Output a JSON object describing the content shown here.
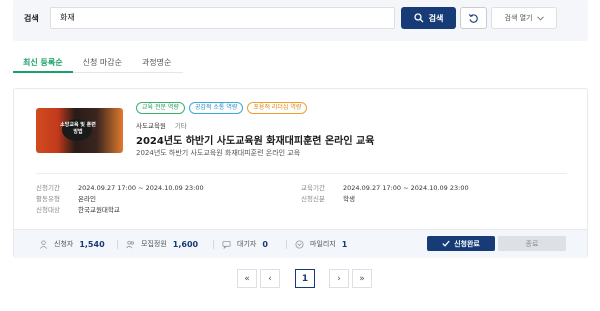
{
  "search": {
    "label": "검색",
    "value": "화재",
    "button_label": "검색",
    "open_label": "검색 열기"
  },
  "tabs": [
    {
      "label": "최신 등록순",
      "active": true
    },
    {
      "label": "신청 마감순",
      "active": false
    },
    {
      "label": "과정명순",
      "active": false
    }
  ],
  "course": {
    "thumbnail_text": "소방교육 및 훈련방법",
    "tags": [
      "교육 전문 역량",
      "공감적 소통 역량",
      "포용적 리더십 역량"
    ],
    "organization": "사도교육원",
    "category": "기타",
    "title": "2024년도 하반기 사도교육원 화재대피훈련 온라인 교육",
    "subtitle": "2024년도 하반기 사도교육원 화재대피훈련 온라인 교육",
    "info_left": [
      {
        "key": "신청기간",
        "value": "2024.09.27 17:00 ~ 2024.10.09 23:00"
      },
      {
        "key": "활동유형",
        "value": "온라인"
      },
      {
        "key": "신청대상",
        "value": "한국교원대학교"
      }
    ],
    "info_right": [
      {
        "key": "교육기간",
        "value": "2024.09.27 17:00 ~ 2024.10.09 23:00"
      },
      {
        "key": "신청신분",
        "value": "학생"
      }
    ],
    "stats": {
      "applicants_label": "신청자",
      "applicants": "1,540",
      "capacity_label": "모집정원",
      "capacity": "1,600",
      "waiting_label": "대기자",
      "waiting": "0",
      "mileage_label": "마일리지",
      "mileage": "1"
    },
    "done_label": "신청완료",
    "end_label": "종료"
  },
  "pagination": {
    "first": "«",
    "prev": "‹",
    "current": "1",
    "next": "›",
    "last": "»"
  },
  "colors": {
    "primary": "#173b76",
    "accent_green": "#19a06b"
  }
}
